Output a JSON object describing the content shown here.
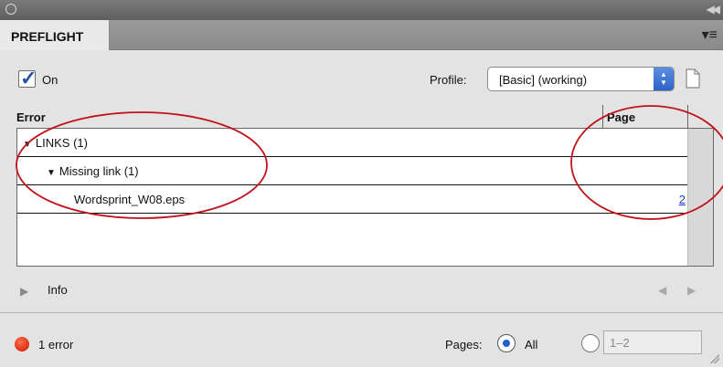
{
  "panel": {
    "tab_label": "PREFLIGHT",
    "on_label": "On",
    "on_checked": true,
    "profile_label": "Profile:",
    "profile_value": "[Basic] (working)"
  },
  "table": {
    "col_error": "Error",
    "col_page": "Page",
    "rows": [
      {
        "label": "LINKS (1)",
        "page": ""
      },
      {
        "label": "Missing link (1)",
        "page": ""
      },
      {
        "label": "Wordsprint_W08.eps",
        "page": "2"
      }
    ]
  },
  "info": {
    "label": "Info"
  },
  "status": {
    "error_text": "1 error",
    "pages_label": "Pages:",
    "all_label": "All",
    "range_value": "1–2"
  },
  "colors": {
    "error_dot": "#d9250a",
    "annotation": "#c0121a",
    "link": "#1a3fd0"
  }
}
